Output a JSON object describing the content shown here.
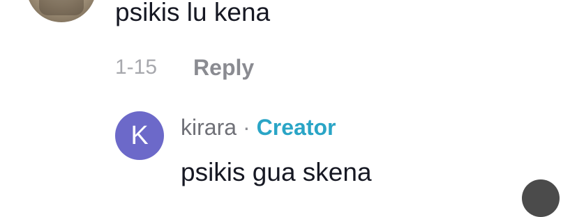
{
  "comment": {
    "text": "psikis lu kena",
    "date": "1-15",
    "reply_label": "Reply"
  },
  "reply_comment": {
    "avatar_letter": "K",
    "avatar_color": "#6c69c9",
    "author": "kirara",
    "separator": "·",
    "badge": "Creator",
    "badge_color": "#2aa5c6",
    "text": "psikis gua skena"
  }
}
